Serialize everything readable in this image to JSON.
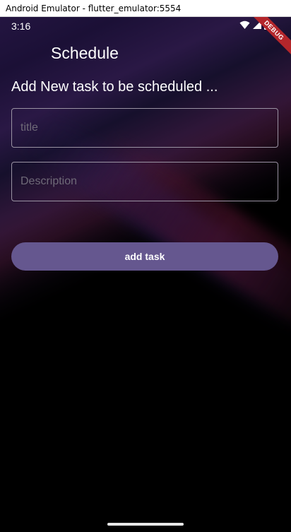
{
  "window": {
    "title": "Android Emulator - flutter_emulator:5554"
  },
  "status_bar": {
    "time": "3:16",
    "debug_label": "DEBUG"
  },
  "app_bar": {
    "title": "Schedule"
  },
  "form": {
    "heading": "Add New task to be scheduled ...",
    "title_field": {
      "placeholder": "title",
      "value": ""
    },
    "description_field": {
      "placeholder": "Description",
      "value": ""
    },
    "submit_label": "add task"
  },
  "colors": {
    "button": "#65578f",
    "field_border": "#9a93a3",
    "placeholder": "#6f6a78",
    "debug_ribbon": "#b3262b"
  },
  "icons": [
    "wifi-icon",
    "cell-signal-icon",
    "battery-icon"
  ]
}
